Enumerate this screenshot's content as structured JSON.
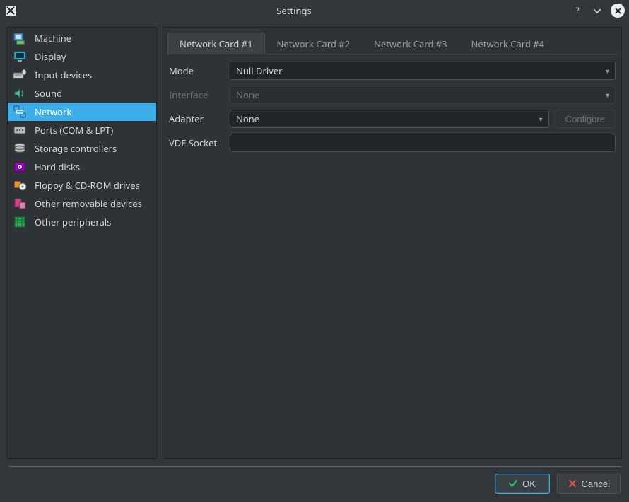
{
  "window": {
    "title": "Settings"
  },
  "sidebar": {
    "items": [
      {
        "label": "Machine"
      },
      {
        "label": "Display"
      },
      {
        "label": "Input devices"
      },
      {
        "label": "Sound"
      },
      {
        "label": "Network"
      },
      {
        "label": "Ports (COM & LPT)"
      },
      {
        "label": "Storage controllers"
      },
      {
        "label": "Hard disks"
      },
      {
        "label": "Floppy & CD-ROM drives"
      },
      {
        "label": "Other removable devices"
      },
      {
        "label": "Other peripherals"
      }
    ],
    "selected_index": 4
  },
  "tabs": {
    "items": [
      {
        "label": "Network Card #1"
      },
      {
        "label": "Network Card #2"
      },
      {
        "label": "Network Card #3"
      },
      {
        "label": "Network Card #4"
      }
    ],
    "active_index": 0
  },
  "form": {
    "mode": {
      "label": "Mode",
      "value": "Null Driver"
    },
    "interface": {
      "label": "Interface",
      "value": "None"
    },
    "adapter": {
      "label": "Adapter",
      "value": "None",
      "configure_label": "Configure"
    },
    "vde": {
      "label": "VDE Socket",
      "value": ""
    }
  },
  "footer": {
    "ok": "OK",
    "cancel": "Cancel"
  }
}
